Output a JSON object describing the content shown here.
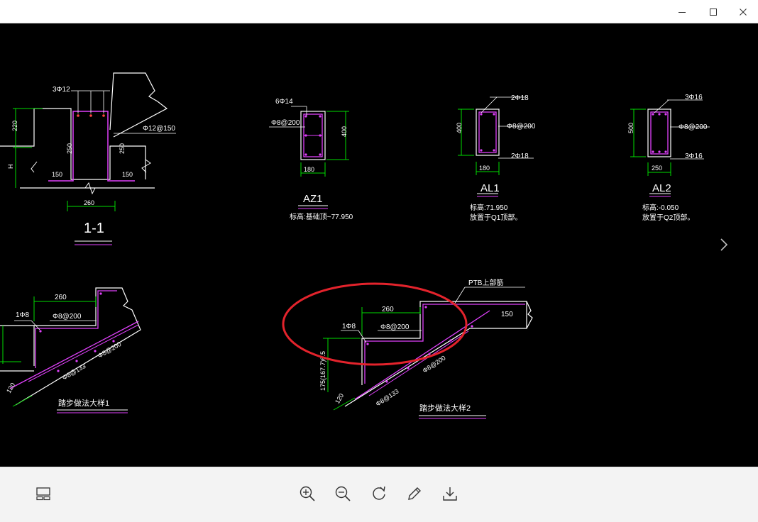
{
  "window": {
    "controls": {
      "minimize_icon": "minimize-icon",
      "maximize_icon": "maximize-icon",
      "close_icon": "close-icon"
    }
  },
  "drawing": {
    "section_1_1": {
      "title": "1-1",
      "rebar_top": "3Φ12",
      "rebar_side": "Φ12@150",
      "dim_220": "220",
      "dim_h": "H",
      "dim_250_left": "250",
      "dim_250_right": "250",
      "dim_150_left": "150",
      "dim_150_right": "150",
      "dim_260": "260"
    },
    "az1": {
      "title": "AZ1",
      "rebar_main": "6Φ14",
      "stirrup": "Φ8@200",
      "dim_height": "400",
      "dim_width": "180",
      "note": "标高:基础顶~77.950"
    },
    "al1": {
      "title": "AL1",
      "rebar_top": "2Φ18",
      "stirrup": "Φ8@200",
      "rebar_bottom": "2Φ18",
      "dim_height": "400",
      "dim_width": "180",
      "note_1": "标高:71.950",
      "note_2": "放置于Q1顶部。"
    },
    "al2": {
      "title": "AL2",
      "rebar_top": "3Φ16",
      "stirrup": "Φ8@200",
      "rebar_bottom": "3Φ16",
      "dim_height": "500",
      "dim_width": "250",
      "note_1": "标高:-0.050",
      "note_2": "放置于Q2顶部。"
    },
    "stair_1": {
      "title": "踏步做法大样1",
      "dim_260": "260",
      "rebar_1": "1Φ8",
      "rebar_2": "Φ8@200",
      "rebar_3": "Φ8@200",
      "rebar_4": "Φ8@133",
      "dim_120": "120"
    },
    "stair_2": {
      "title": "踏步做法大样2",
      "label_ptb": "PTB上部筋",
      "dim_260": "260",
      "dim_150": "150",
      "rebar_1": "1Φ8",
      "rebar_2": "Φ8@200",
      "rebar_3": "Φ8@200",
      "rebar_4": "Φ8@133",
      "dim_riser": "175(167.7)6.5",
      "dim_120": "120"
    },
    "highlight_color": "#e3232c"
  },
  "colors": {
    "dim_line": "#00dd00",
    "rebar": "#e040fb",
    "text": "#ffffff",
    "outline": "#ffffff"
  },
  "toolbar": {
    "thumbnails_icon": "thumbnails-icon",
    "zoom_in_icon": "zoom-in-icon",
    "zoom_out_icon": "zoom-out-icon",
    "rotate_icon": "rotate-icon",
    "edit_icon": "edit-icon",
    "download_icon": "download-icon"
  }
}
